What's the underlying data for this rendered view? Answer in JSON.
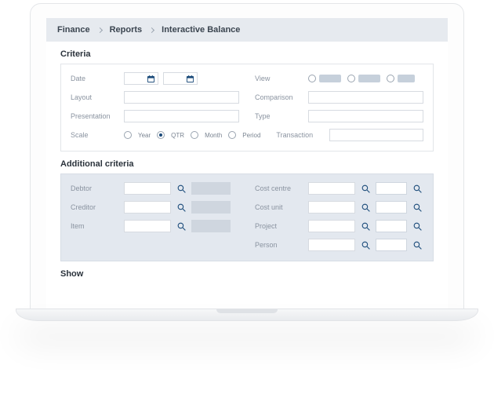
{
  "breadcrumb": {
    "a": "Finance",
    "b": "Reports",
    "c": "Interactive Balance"
  },
  "sections": {
    "criteria": "Criteria",
    "additional": "Additional criteria",
    "show": "Show"
  },
  "labels": {
    "date": "Date",
    "layout": "Layout",
    "presentation": "Presentation",
    "scale": "Scale",
    "view": "View",
    "comparison": "Comparison",
    "type": "Type",
    "transaction": "Transaction",
    "debtor": "Debtor",
    "creditor": "Creditor",
    "item": "Item",
    "costcentre": "Cost centre",
    "costunit": "Cost unit",
    "project": "Project",
    "person": "Person"
  },
  "scale": {
    "year": "Year",
    "qtr": "QTR",
    "month": "Month",
    "period": "Period",
    "selected": "qtr"
  }
}
